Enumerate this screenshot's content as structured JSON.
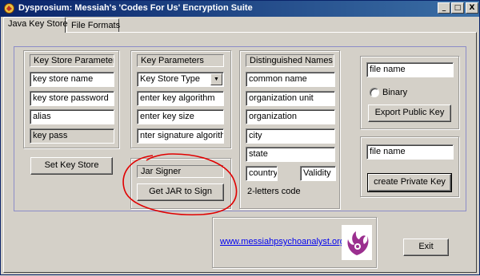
{
  "window": {
    "title": "Dysprosium: Messiah's 'Codes For Us' Encryption Suite",
    "controls": {
      "minimize": "_",
      "maximize": "□",
      "close": "X"
    }
  },
  "tabs": [
    {
      "label": "Java Key Store",
      "active": true
    },
    {
      "label": "File Formats",
      "active": false
    }
  ],
  "keystore_params": {
    "header": "Key Store Parameters",
    "fields": [
      {
        "value": "key store name",
        "editable": true
      },
      {
        "value": "key store password",
        "editable": true
      },
      {
        "value": "alias",
        "editable": true
      },
      {
        "value": "key pass",
        "editable": false
      }
    ],
    "set_button": "Set Key Store"
  },
  "key_params": {
    "header": "Key Parameters",
    "type_select": "Key Store Type",
    "fields": [
      {
        "value": "enter key algorithm"
      },
      {
        "value": "enter key size"
      },
      {
        "value": "nter signature algorithm"
      }
    ]
  },
  "jar_signer": {
    "header": "Jar Signer",
    "button": "Get JAR to Sign"
  },
  "distinguished_names": {
    "header": "Distinguished Names",
    "fields": [
      {
        "value": "common name"
      },
      {
        "value": "organization unit"
      },
      {
        "value": "organization"
      },
      {
        "value": "city"
      },
      {
        "value": "state"
      },
      {
        "value": "country"
      },
      {
        "value": "Validity"
      }
    ],
    "country_hint": "2-letters code"
  },
  "export_public": {
    "file_name": "file name",
    "binary_label": "Binary",
    "binary_checked": false,
    "button": "Export Public Key"
  },
  "create_private": {
    "file_name": "file name",
    "button": "create Private Key"
  },
  "footer": {
    "website": "www.messiahpsychoanalyst.org",
    "logo_icon": "phoenix-logo-icon",
    "exit_button": "Exit"
  },
  "colors": {
    "title_start": "#0a246a",
    "title_end": "#3a6ea5",
    "face": "#d4d0c8",
    "annotation": "#e00000",
    "link": "#0000ee",
    "logo": "#9b2f8f"
  }
}
